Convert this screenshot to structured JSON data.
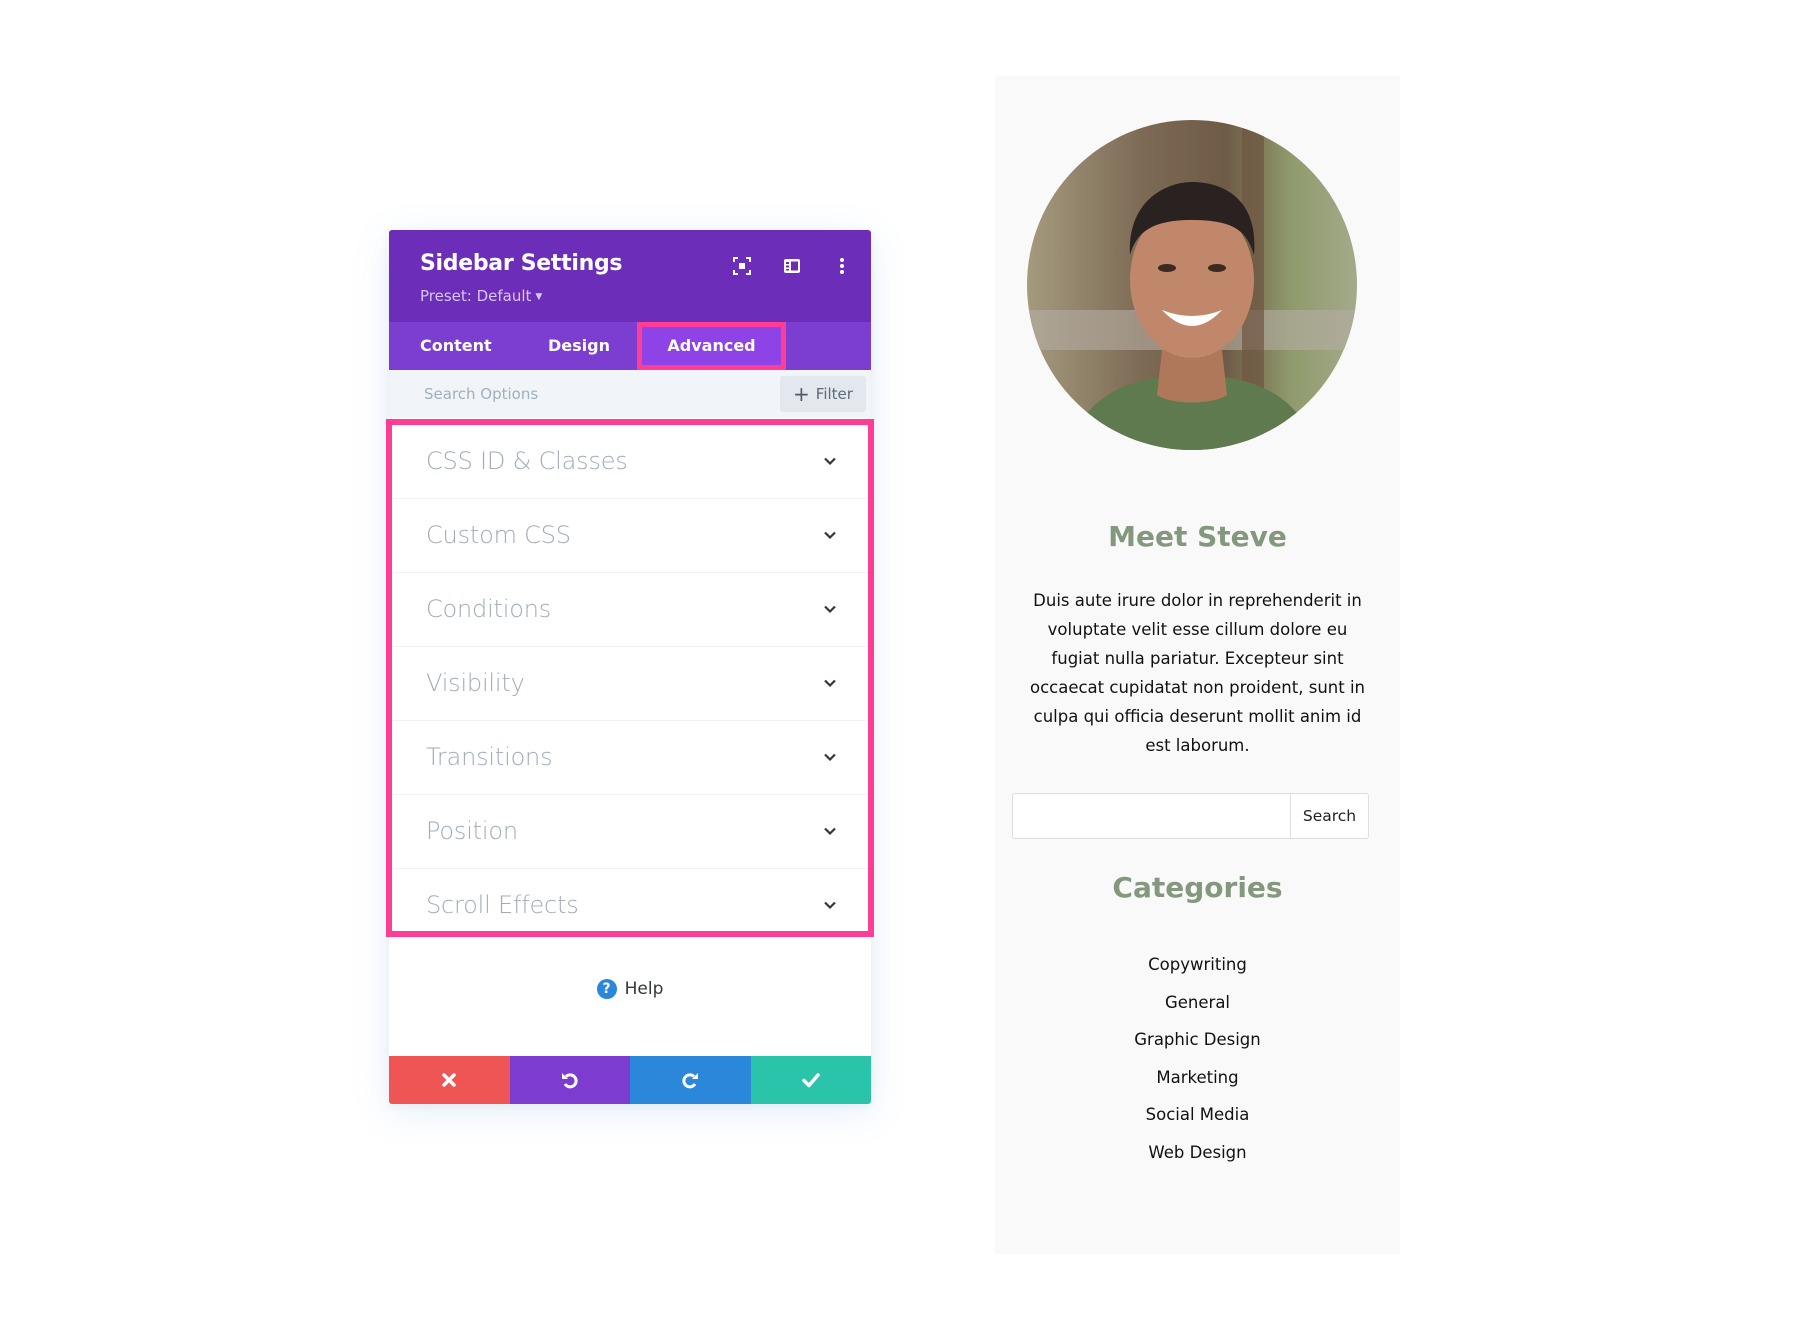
{
  "settings_panel": {
    "title": "Sidebar Settings",
    "preset": "Preset: Default",
    "header_icons": [
      "expand-icon",
      "split-view-icon",
      "more-vertical-icon"
    ],
    "tabs": [
      {
        "label": "Content",
        "active": false
      },
      {
        "label": "Design",
        "active": false
      },
      {
        "label": "Advanced",
        "active": true
      }
    ],
    "search": {
      "placeholder": "Search Options",
      "value": ""
    },
    "filter_label": "Filter",
    "groups": [
      {
        "label": "CSS ID & Classes"
      },
      {
        "label": "Custom CSS"
      },
      {
        "label": "Conditions"
      },
      {
        "label": "Visibility"
      },
      {
        "label": "Transitions"
      },
      {
        "label": "Position"
      },
      {
        "label": "Scroll Effects"
      }
    ],
    "help_label": "Help",
    "footer_buttons": [
      {
        "name": "cancel",
        "icon": "close-icon",
        "color": "#ef5555"
      },
      {
        "name": "undo",
        "icon": "undo-icon",
        "color": "#7e3bd0"
      },
      {
        "name": "redo",
        "icon": "redo-icon",
        "color": "#2b87da"
      },
      {
        "name": "save",
        "icon": "check-icon",
        "color": "#29c4a9"
      }
    ],
    "colors": {
      "header": "#6c2eb9",
      "tabs": "#7b3ed1",
      "active_tab": "#8e43e7",
      "highlight": "#ff3d96"
    }
  },
  "sidebar_preview": {
    "heading": "Meet Steve",
    "bio": "Duis aute irure dolor in reprehenderit in voluptate velit esse cillum dolore eu fugiat nulla pariatur. Excepteur sint occaecat cupidatat non proident, sunt in culpa qui officia deserunt mollit anim id est laborum.",
    "search": {
      "value": "",
      "button_label": "Search"
    },
    "categories_heading": "Categories",
    "categories": [
      "Copywriting",
      "General",
      "Graphic Design",
      "Marketing",
      "Social Media",
      "Web Design"
    ],
    "heading_color": "#84987d"
  }
}
